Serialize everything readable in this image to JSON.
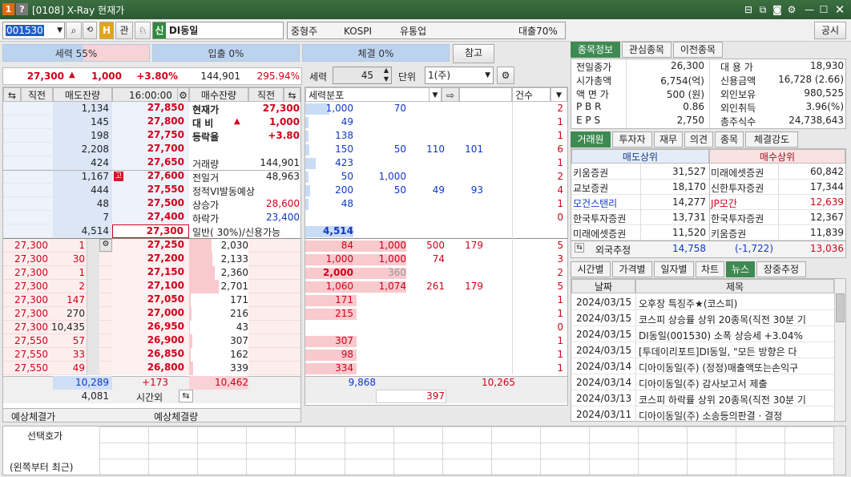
{
  "window": {
    "id": "[0108]",
    "title": "X-Ray 현재가",
    "icon1": "1",
    "icon2": "?"
  },
  "toolbar": {
    "code": "001530",
    "search_icon": "magnifier-icon",
    "btn_h": "H",
    "gwan": "관",
    "badge": "신",
    "name": "DI동일",
    "sector": "중형주",
    "market": "KOSPI",
    "industry": "유통업",
    "loan": "대출70%",
    "notice_btn": "공시"
  },
  "strength": {
    "power": "세력 55%",
    "inout": "입출 0%",
    "exec": "체결 0%",
    "ref_btn": "참고",
    "power_pct": 55
  },
  "price": {
    "current": "27,300",
    "arrow": "▲",
    "change": "1,000",
    "rate": "+3.80%",
    "volume": "144,901",
    "ratio": "295.94%"
  },
  "ctrl": {
    "power_label": "세력",
    "power_val": "45",
    "unit_label": "단위",
    "unit_val": "1(주)"
  },
  "ob_headers": {
    "prev": "직전",
    "sell_qty": "매도잔량",
    "time": "16:00:00",
    "buy_qty": "매수잔량",
    "prev2": "직전"
  },
  "asks": [
    {
      "qty": "1,134",
      "price": "27,850"
    },
    {
      "qty": "145",
      "price": "27,800"
    },
    {
      "qty": "198",
      "price": "27,750"
    },
    {
      "qty": "2,208",
      "price": "27,700"
    },
    {
      "qty": "424",
      "price": "27,650"
    },
    {
      "qty": "1,167",
      "price": "27,600",
      "mark": "고"
    },
    {
      "qty": "444",
      "price": "27,550"
    },
    {
      "qty": "48",
      "price": "27,500"
    },
    {
      "qty": "7",
      "price": "27,400"
    },
    {
      "qty": "4,514",
      "price": "27,300"
    }
  ],
  "ask_info": [
    {
      "label": "현재가",
      "value": "27,300"
    },
    {
      "label": "대 비",
      "value": "1,000",
      "arrow": "▲"
    },
    {
      "label": "등락율",
      "value": "+3.80"
    },
    {
      "label": "",
      "value": ""
    },
    {
      "label": "거래량",
      "value": "144,901"
    },
    {
      "label": "전일거",
      "value": "48,963"
    },
    {
      "label": "정적VI발동예상",
      "value": ""
    },
    {
      "label": "상승가",
      "value": "28,600"
    },
    {
      "label": "하락가",
      "value": "23,400"
    },
    {
      "label": "일반( 30%)/신용가능",
      "value": ""
    }
  ],
  "bids": [
    {
      "prev": "27,300",
      "tq": "1",
      "price": "27,250",
      "qty": "2,030"
    },
    {
      "prev": "27,300",
      "tq": "30",
      "price": "27,200",
      "qty": "2,133"
    },
    {
      "prev": "27,300",
      "tq": "1",
      "price": "27,150",
      "qty": "2,360"
    },
    {
      "prev": "27,300",
      "tq": "2",
      "price": "27,100",
      "qty": "2,701"
    },
    {
      "prev": "27,300",
      "tq": "147",
      "price": "27,050",
      "qty": "171"
    },
    {
      "prev": "27,300",
      "tq": "270",
      "price": "27,000",
      "qty": "216"
    },
    {
      "prev": "27,300",
      "tq": "10,435",
      "price": "26,950",
      "qty": "43"
    },
    {
      "prev": "27,550",
      "tq": "57",
      "price": "26,900",
      "qty": "307"
    },
    {
      "prev": "27,550",
      "tq": "33",
      "price": "26,850",
      "qty": "162"
    },
    {
      "prev": "27,550",
      "tq": "49",
      "price": "26,800",
      "qty": "339"
    }
  ],
  "ob_totals": {
    "sell_total": "10,289",
    "diff": "+173",
    "buy_total": "10,462",
    "after": "4,081",
    "after_label": "시간외"
  },
  "expect": {
    "price_label": "예상체결가",
    "qty_label": "예상체결량"
  },
  "power_dist": {
    "header": "세력분포",
    "count_header": "건수",
    "ask_rows": [
      [
        "1,000",
        "70",
        "",
        "",
        "2"
      ],
      [
        "49",
        "",
        "",
        "",
        "1"
      ],
      [
        "138",
        "",
        "",
        "",
        "1"
      ],
      [
        "150",
        "50",
        "110",
        "101",
        "6"
      ],
      [
        "423",
        "",
        "",
        "",
        "1"
      ],
      [
        "50",
        "1,000",
        "",
        "",
        "2"
      ],
      [
        "200",
        "50",
        "49",
        "93",
        "4"
      ],
      [
        "48",
        "",
        "",
        "",
        "1"
      ],
      [
        "",
        "",
        "",
        "",
        "0"
      ],
      [
        "4,514",
        "",
        "",
        "",
        ""
      ]
    ],
    "bid_rows": [
      [
        "84",
        "1,000",
        "500",
        "179",
        "5"
      ],
      [
        "1,000",
        "1,000",
        "74",
        "",
        "3"
      ],
      [
        "2,000",
        "360",
        "",
        "",
        "2"
      ],
      [
        "1,060",
        "1,074",
        "261",
        "179",
        "5"
      ],
      [
        "171",
        "",
        "",
        "",
        "1"
      ],
      [
        "215",
        "",
        "",
        "",
        "1"
      ],
      [
        "",
        "",
        "",
        "",
        "0"
      ],
      [
        "307",
        "",
        "",
        "",
        "1"
      ],
      [
        "98",
        "",
        "",
        "",
        "1"
      ],
      [
        "334",
        "",
        "",
        "",
        "1"
      ]
    ],
    "total_sell": "9,868",
    "total_buy": "10,265",
    "diff": "397"
  },
  "stock_tabs": [
    "종목정보",
    "관심종목",
    "이전종목"
  ],
  "stock_info": [
    {
      "k1": "전일종가",
      "v1": "26,300",
      "k2": "대 용 가",
      "v2": "18,930"
    },
    {
      "k1": "시가총액",
      "v1": "6,754(억)",
      "k2": "신용금액",
      "v2": "16,728  (2.66)"
    },
    {
      "k1": "액 면 가",
      "v1": "500 (원)",
      "k2": "외인보유",
      "v2": "980,525"
    },
    {
      "k1": "P B R",
      "v1": "0.86",
      "k2": "외인취득",
      "v2": "3.96(%)"
    },
    {
      "k1": "E P S",
      "v1": "2,750",
      "k2": "총주식수",
      "v2": "24,738,643"
    }
  ],
  "broker_tabs": [
    "거래원",
    "투자자",
    "재무",
    "의견",
    "종목",
    "체결강도"
  ],
  "broker": {
    "sell_header": "매도상위",
    "buy_header": "매수상위",
    "rows": [
      {
        "s": "키움증권",
        "sq": "31,527",
        "b": "미래에셋증권",
        "bq": "60,842"
      },
      {
        "s": "교보증권",
        "sq": "18,170",
        "b": "신한투자증권",
        "bq": "17,344"
      },
      {
        "s": "모건스탠리",
        "sq": "14,277",
        "b": "JP모간",
        "bq": "12,639",
        "sf": true,
        "bf": true
      },
      {
        "s": "한국투자증권",
        "sq": "13,731",
        "b": "한국투자증권",
        "bq": "12,367"
      },
      {
        "s": "미래에셋증권",
        "sq": "11,520",
        "b": "키움증권",
        "bq": "11,839"
      }
    ],
    "foreign_label": "외국추정",
    "foreign_sell": "14,758",
    "foreign_net": "(-1,722)",
    "foreign_buy": "13,036"
  },
  "news_tabs": [
    "시간별",
    "가격별",
    "일자별",
    "차트",
    "뉴스",
    "장중추정"
  ],
  "news": {
    "date_header": "날짜",
    "title_header": "제목",
    "items": [
      {
        "d": "2024/03/15",
        "t": "오후장 특징주★(코스피)"
      },
      {
        "d": "2024/03/15",
        "t": "코스피 상승률 상위 20종목(직전 30분 기"
      },
      {
        "d": "2024/03/15",
        "t": "DI동일(001530) 소폭 상승세 +3.04%"
      },
      {
        "d": "2024/03/15",
        "t": "[투데이리포트]DI동일, \"모든 방향은 다"
      },
      {
        "d": "2024/03/14",
        "t": "디아이동일(주) (정정)매출액또는손익구"
      },
      {
        "d": "2024/03/14",
        "t": "디아이동일(주) 감사보고서 제출"
      },
      {
        "d": "2024/03/13",
        "t": "코스피 하락률 상위 20종목(직전 30분 기"
      },
      {
        "d": "2024/03/11",
        "t": "디아이동일(주) 소송등의판결 · 결정"
      }
    ]
  },
  "bottom": {
    "sel_label": "선택호가",
    "hint": "(왼쪽부터 최근)"
  },
  "colors": {
    "title_bg": "#2c5a33",
    "ask_bg": "#e6eefb",
    "bid_bg": "#fde8e8",
    "up": "#d0021b",
    "down": "#1038c8"
  }
}
